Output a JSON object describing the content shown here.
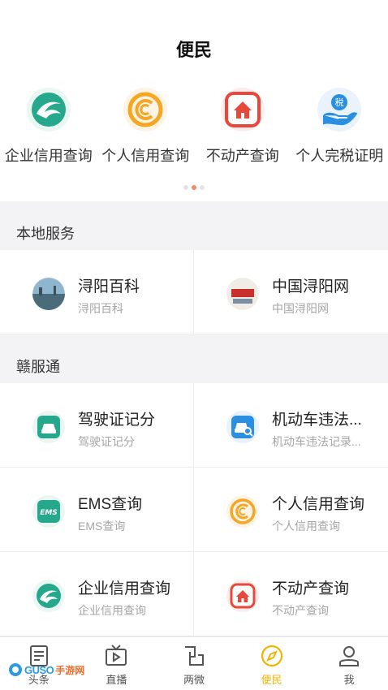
{
  "header": {
    "title": "便民"
  },
  "quick_services": [
    {
      "label": "企业信用查询",
      "icon": "enterprise-credit-icon"
    },
    {
      "label": "个人信用查询",
      "icon": "personal-credit-icon"
    },
    {
      "label": "不动产查询",
      "icon": "real-estate-icon"
    },
    {
      "label": "个人完税证明",
      "icon": "tax-certificate-icon",
      "badge": "税"
    }
  ],
  "carousel": {
    "page": 2,
    "total": 3
  },
  "local_services": {
    "title": "本地服务",
    "items": [
      {
        "name": "浔阳百科",
        "sub": "浔阳百科"
      },
      {
        "name": "中国浔阳网",
        "sub": "中国浔阳网"
      }
    ]
  },
  "ganfutong": {
    "title": "赣服通",
    "items": [
      {
        "name": "驾驶证记分",
        "sub": "驾驶证记分"
      },
      {
        "name": "机动车违法...",
        "sub": "机动车违法记录..."
      },
      {
        "name": "EMS查询",
        "sub": "EMS查询",
        "icon_text": "EMS"
      },
      {
        "name": "个人信用查询",
        "sub": "个人信用查询"
      },
      {
        "name": "企业信用查询",
        "sub": "企业信用查询"
      },
      {
        "name": "不动产查询",
        "sub": "不动产查询"
      }
    ]
  },
  "tabbar": {
    "items": [
      {
        "label": "头条"
      },
      {
        "label": "直播"
      },
      {
        "label": "两微"
      },
      {
        "label": "便民",
        "active": true
      },
      {
        "label": "我"
      }
    ]
  },
  "watermark": {
    "logo_text": "GUSO",
    "cn_text": "手游网"
  },
  "colors": {
    "teal": "#26a88c",
    "orange": "#f5a623",
    "red": "#e8473b",
    "blue": "#2a8fe0",
    "active_tab": "#f0b400",
    "section_bg": "#f3f3f5"
  }
}
